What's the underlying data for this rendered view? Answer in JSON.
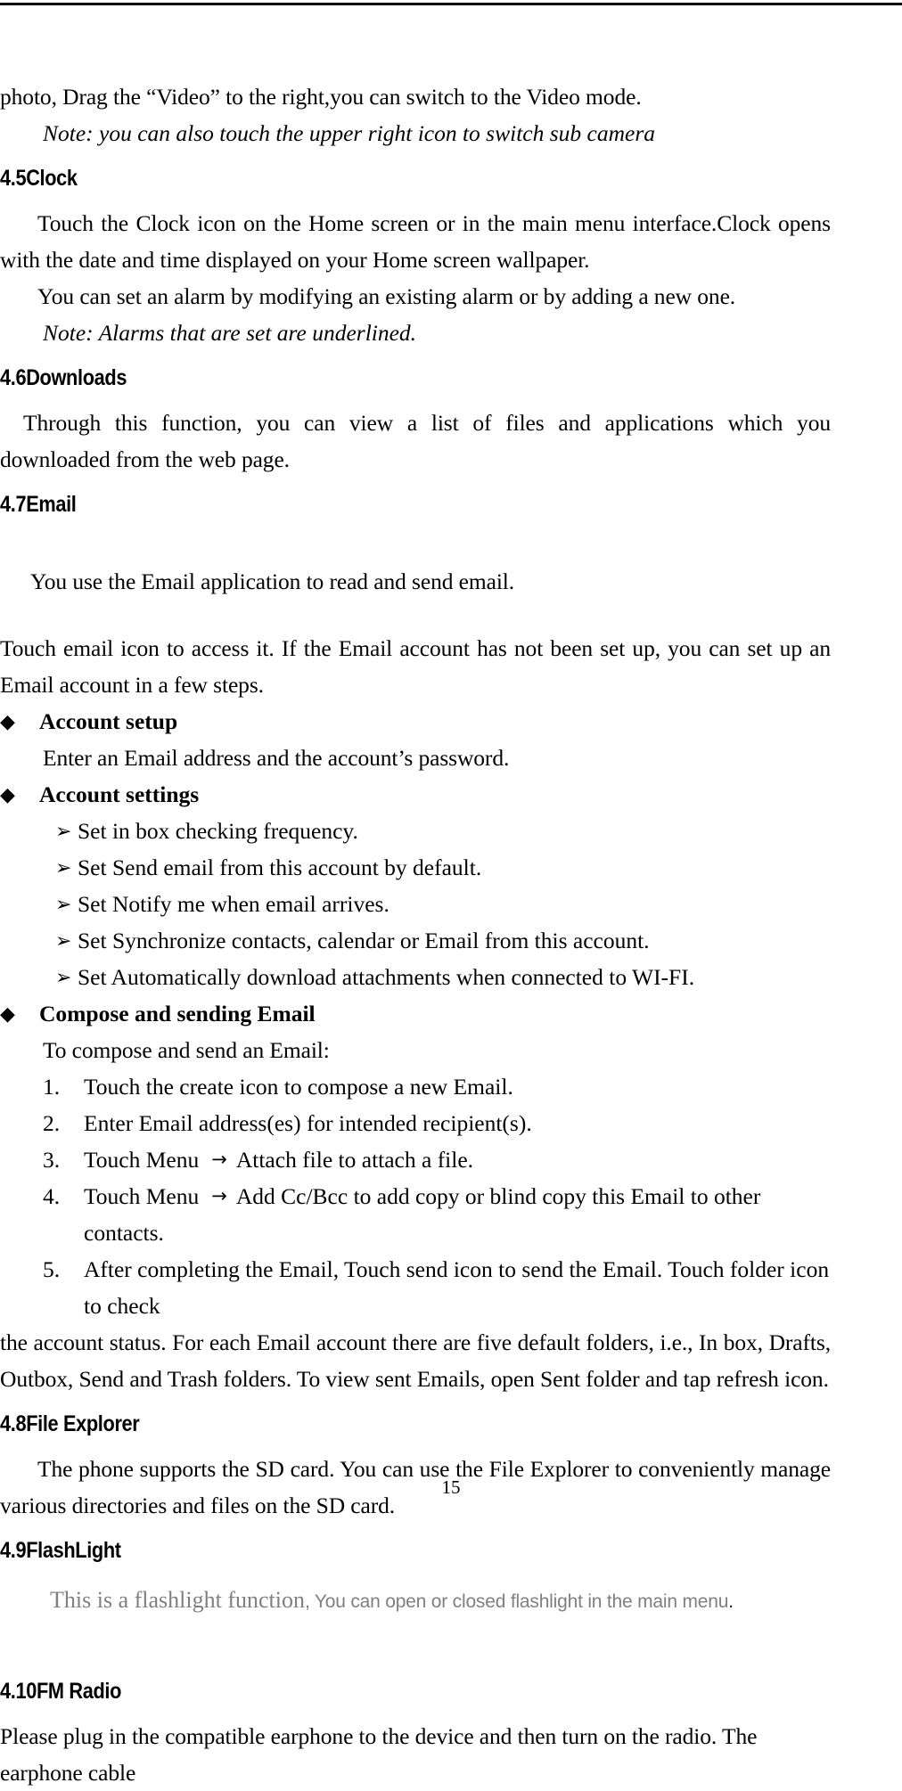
{
  "document": {
    "page_number": "15",
    "top_rule": true
  },
  "intro": {
    "continued_paragraph": "photo, Drag the “Video” to the right,you can switch to the Video mode.",
    "note": "Note: you can also touch the upper right icon to switch sub camera"
  },
  "sections": {
    "clock": {
      "heading": "4.5Clock",
      "p1": "Touch the Clock icon on the Home screen or in the main menu interface.Clock opens with the date and time displayed on your Home screen wallpaper.",
      "p2": "You can set an alarm by modifying an existing alarm or by adding a new one.",
      "note": "Note: Alarms that are set are underlined."
    },
    "downloads": {
      "heading": "4.6Downloads",
      "p1": "Through this function, you can view a list of files and applications which you downloaded from the web page."
    },
    "email": {
      "heading": "4.7Email",
      "p1": "You use the Email application to read and send email.",
      "p2": "Touch email icon to access it. If the Email account has not been set up, you can set up an Email account in a few steps.",
      "bullets": [
        {
          "marker": "◆",
          "title": "Account setup",
          "lines": [
            "Enter an Email address and the account’s password."
          ],
          "subitems": []
        },
        {
          "marker": "◆",
          "title": "Account settings",
          "lines": [],
          "subitems": [
            {
              "marker": "➢",
              "text": "Set in box checking frequency."
            },
            {
              "marker": "➢",
              "text": "Set Send email from this account by default."
            },
            {
              "marker": "➢",
              "text": "Set Notify me when email arrives."
            },
            {
              "marker": "➢",
              "text": "Set Synchronize contacts, calendar or Email from this account."
            },
            {
              "marker": "➢",
              "text": "Set Automatically download attachments when connected to WI-FI."
            }
          ]
        },
        {
          "marker": "◆",
          "title": "Compose and sending Email",
          "lines": [
            "To compose and send an Email:"
          ],
          "subitems": []
        }
      ],
      "numbered": [
        {
          "num": "1.",
          "pre": "Touch the create icon to compose a new Email.",
          "arrow": "",
          "post": ""
        },
        {
          "num": "2.",
          "pre": "Enter Email address(es) for intended recipient(s).",
          "arrow": "",
          "post": ""
        },
        {
          "num": "3.",
          "pre": "Touch Menu",
          "arrow": "→",
          "post": "Attach file to attach a file."
        },
        {
          "num": "4.",
          "pre": "Touch Menu",
          "arrow": "→",
          "post": "Add Cc/Bcc to add copy or blind copy this Email to other contacts."
        },
        {
          "num": "5.",
          "pre": "After completing the Email, Touch send icon to send the Email. Touch folder icon to check",
          "arrow": "",
          "post": ""
        }
      ],
      "tail": "the account status. For each Email account there are five default folders, i.e., In box, Drafts, Outbox, Send and Trash folders. To view sent Emails, open Sent folder and tap refresh icon."
    },
    "file_explorer": {
      "heading": "4.8File Explorer",
      "p1": "The phone supports the SD card. You can use the File Explorer to conveniently manage various directories and files on the SD card."
    },
    "flashlight": {
      "heading": "4.9FlashLight",
      "serif_part": "This is a flashlight function",
      "sans_part": ", You can open or closed flashlight in the main menu",
      "end_part": "."
    },
    "fm_radio": {
      "heading": "4.10FM Radio",
      "p1": "Please plug in the compatible earphone to the device and then turn on the radio. The earphone cable"
    }
  },
  "colors": {
    "text": "#000000",
    "muted": "#808080",
    "rule": "#000000"
  }
}
